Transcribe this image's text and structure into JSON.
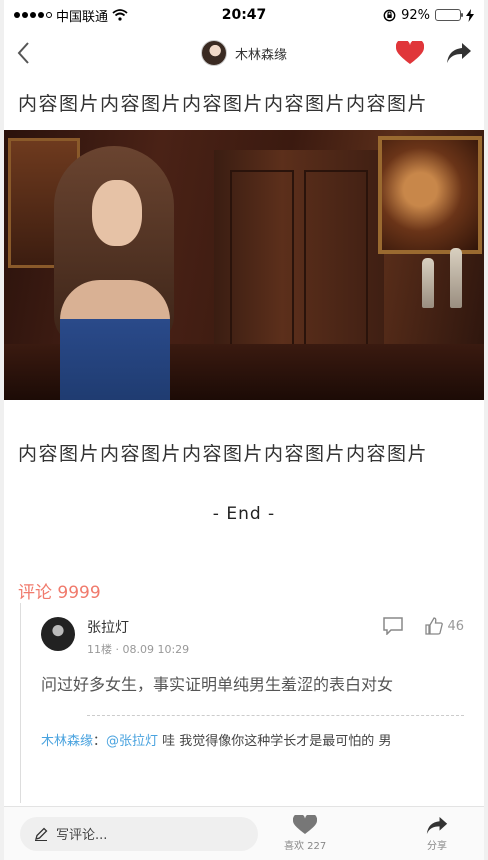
{
  "status": {
    "carrier": "中国联通",
    "time": "20:47",
    "battery": "92%",
    "battery_level": 0.92
  },
  "nav": {
    "author_name": "木林森缘"
  },
  "article": {
    "title_top": "内容图片内容图片内容图片内容图片内容图片",
    "title_bottom": "内容图片内容图片内容图片内容图片内容图片",
    "end_text": "- End -"
  },
  "comments": {
    "header": "评论 9999",
    "items": [
      {
        "name": "张拉灯",
        "meta": "11楼 · 08.09 10:29",
        "likes": "46",
        "text": "问过好多女生，事实证明单纯男生羞涩的表白对女",
        "reply_author": "木林森缘",
        "reply_sep": "：",
        "reply_mention": "@张拉灯",
        "reply_text": " 哇  我觉得像你这种学长才是最可怕的 男"
      }
    ]
  },
  "bottombar": {
    "write_placeholder": "写评论...",
    "like_label": "喜欢 227",
    "share_label": "分享"
  },
  "colors": {
    "heart": "#e0363a",
    "accent_comment": "#f07a6c",
    "link": "#4aa3df"
  }
}
